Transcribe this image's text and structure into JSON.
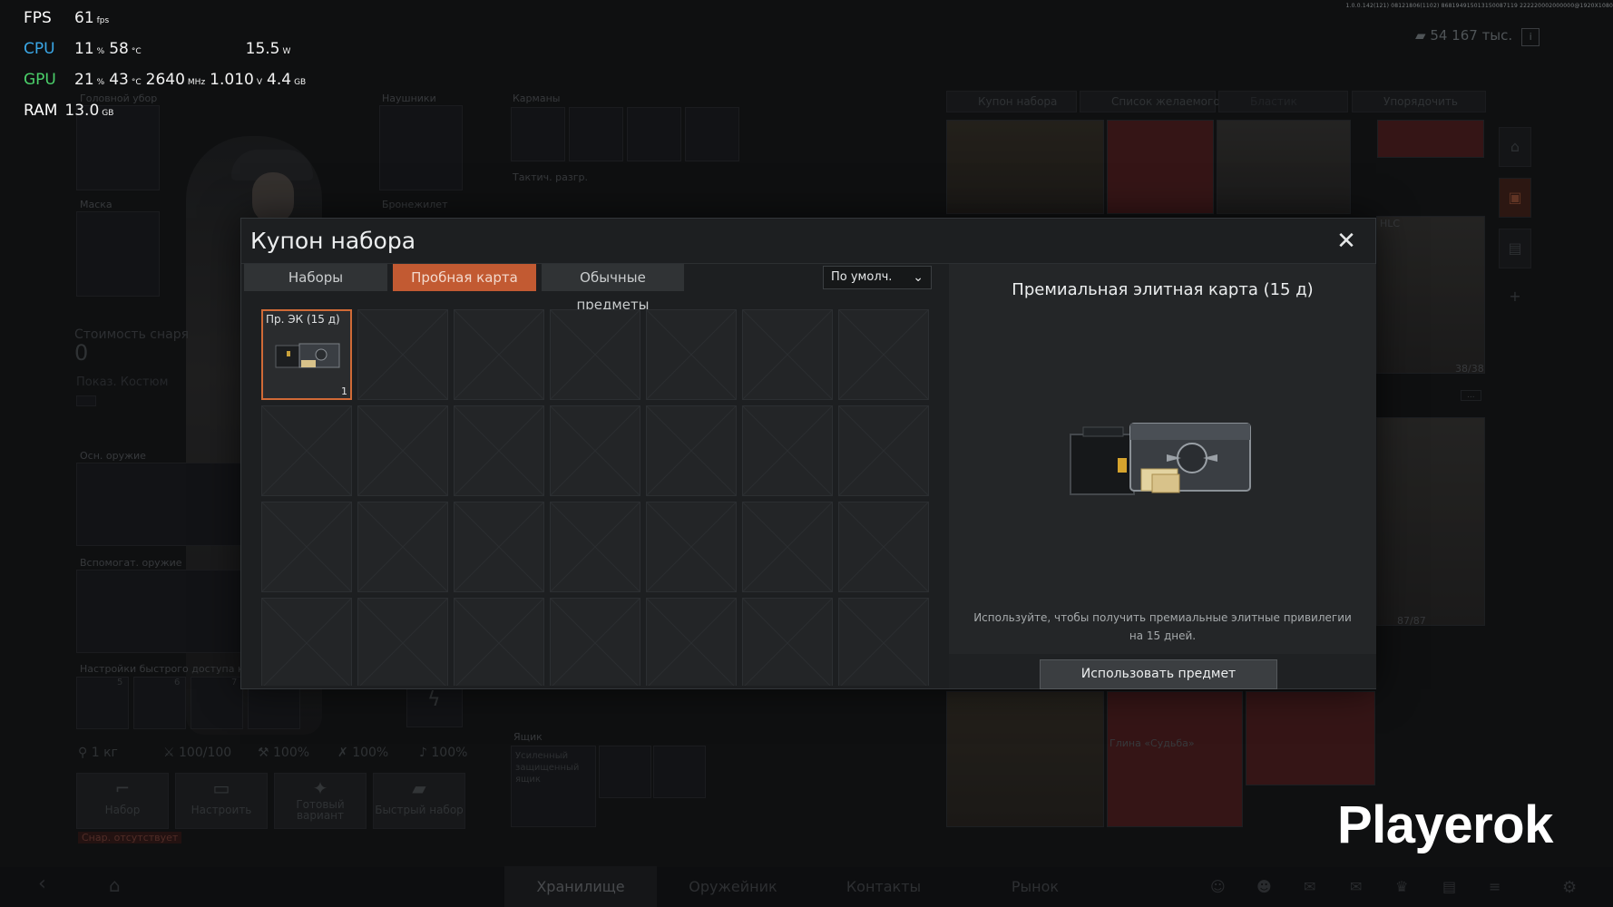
{
  "hud": {
    "fps": {
      "label": "FPS",
      "value": "61",
      "unit": "fps"
    },
    "cpu": {
      "label": "CPU",
      "load": "11",
      "load_unit": "%",
      "temp": "58",
      "temp_unit": "°C",
      "power": "15.5",
      "power_unit": "W"
    },
    "gpu": {
      "label": "GPU",
      "load": "21",
      "load_unit": "%",
      "temp": "43",
      "temp_unit": "°C",
      "clock": "2640",
      "clock_unit": "MHz",
      "voltage": "1.010",
      "voltage_unit": "V",
      "mem": "4.4",
      "mem_unit": "GB"
    },
    "ram": {
      "label": "RAM",
      "value": "13.0",
      "unit": "GB"
    }
  },
  "top_right_code": "1.0.0.142(121) 08121806(1102) 868194915013150087119 222220002000000@1920X1080",
  "currency": {
    "value": "54 167 тыс.",
    "info": "i"
  },
  "inventory": {
    "slots": {
      "headwear": "Головной убор",
      "headset": "Наушники",
      "pockets": "Карманы",
      "tactical_rig": "Тактич. разгр.",
      "mask": "Маска",
      "armor": "Бронежилет",
      "primary_weapon": "Осн. оружие",
      "secondary_weapon": "Вспомогат. оружие",
      "quick_access": "Настройки быстрого доступа к п",
      "box": "Ящик",
      "box_item": "Усиленный защищенный ящик"
    },
    "quick_slot_numbers": [
      "5",
      "6",
      "7"
    ],
    "outfit_cost_label": "Стоимость снаря",
    "outfit_cost_value": "0",
    "costume_display_label": "Показ. Костюм",
    "stats": {
      "weight": "1 кг",
      "durability": "100/100",
      "stat2": "100%",
      "stat3": "100%",
      "stat4": "100%"
    },
    "actions": {
      "loadout": "Набор",
      "configure": "Настроить",
      "preset": "Готовый вариант",
      "quick_set": "Быстрый набор",
      "missing": "Снар. отсутствует"
    }
  },
  "storage_toolbar": {
    "kit_coupon": "Купон набора",
    "wishlist": "Список желаемого",
    "disabled": "Бластик",
    "sort": "Упорядочить"
  },
  "storage": {
    "slot_hlc": "HLC",
    "capacity_1": "38/38",
    "capacity_2": "87/87",
    "fate_clay": "Глина «Судьба»",
    "more": "..."
  },
  "side_icons": [
    "⌂",
    "▣",
    "▤",
    "+"
  ],
  "bottom_nav": {
    "back": "‹",
    "home": "⌂",
    "tabs": [
      "Хранилище",
      "Оружейник",
      "Контакты",
      "Рынок"
    ]
  },
  "watermark": "Playerok",
  "modal": {
    "title": "Купон набора",
    "close": "✕",
    "tabs": [
      {
        "label": "Наборы",
        "active": false
      },
      {
        "label": "Пробная карта",
        "active": true
      },
      {
        "label": "Обычные предметы",
        "active": false
      }
    ],
    "sort_select": {
      "value": "По умолч."
    },
    "items": [
      {
        "name": "Пр. ЭК (15 д)",
        "qty": "1"
      }
    ],
    "detail": {
      "title": "Премиальная элитная карта (15 д)",
      "description": "Используйте, чтобы получить премиальные элитные привилегии на 15 дней.",
      "use_button": "Использовать предмет"
    }
  },
  "colors": {
    "accent": "#c25a32",
    "accent_border": "#d06a36",
    "cpu": "#3aa7e6",
    "gpu": "#4bd06a"
  }
}
